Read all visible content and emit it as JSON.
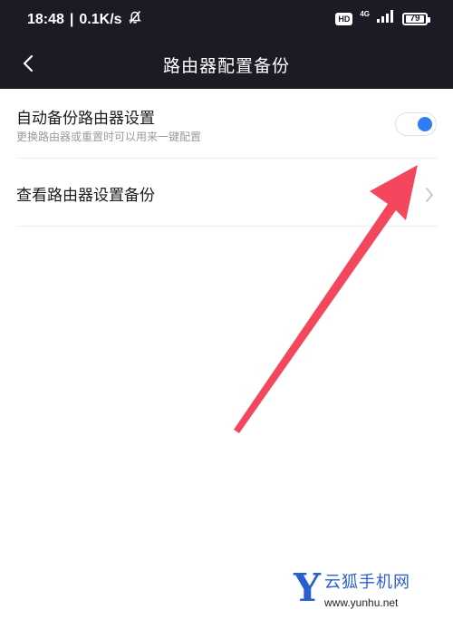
{
  "status_bar": {
    "time": "18:48",
    "divider": "|",
    "network_speed": "0.1K/s",
    "mute_icon": "bell-off-icon",
    "hd_label": "HD",
    "network_type": "4G",
    "signal_icon": "signal-bars-icon",
    "battery_level": "79"
  },
  "header": {
    "back_icon": "chevron-left-icon",
    "title": "路由器配置备份"
  },
  "settings": {
    "auto_backup": {
      "title": "自动备份路由器设置",
      "subtitle": "更换路由器或重置时可以用来一键配置",
      "enabled": true
    },
    "view_backup": {
      "title": "查看路由器设置备份",
      "icon": "chevron-right-icon"
    }
  },
  "watermark": {
    "logo_letter": "Y",
    "name": "云狐手机网",
    "url": "www.yunhu.net"
  },
  "colors": {
    "header_bg": "#1b1b26",
    "toggle_on": "#2f7cf6",
    "annotation_arrow": "#f4475d",
    "watermark_blue": "#2a5fd0"
  }
}
